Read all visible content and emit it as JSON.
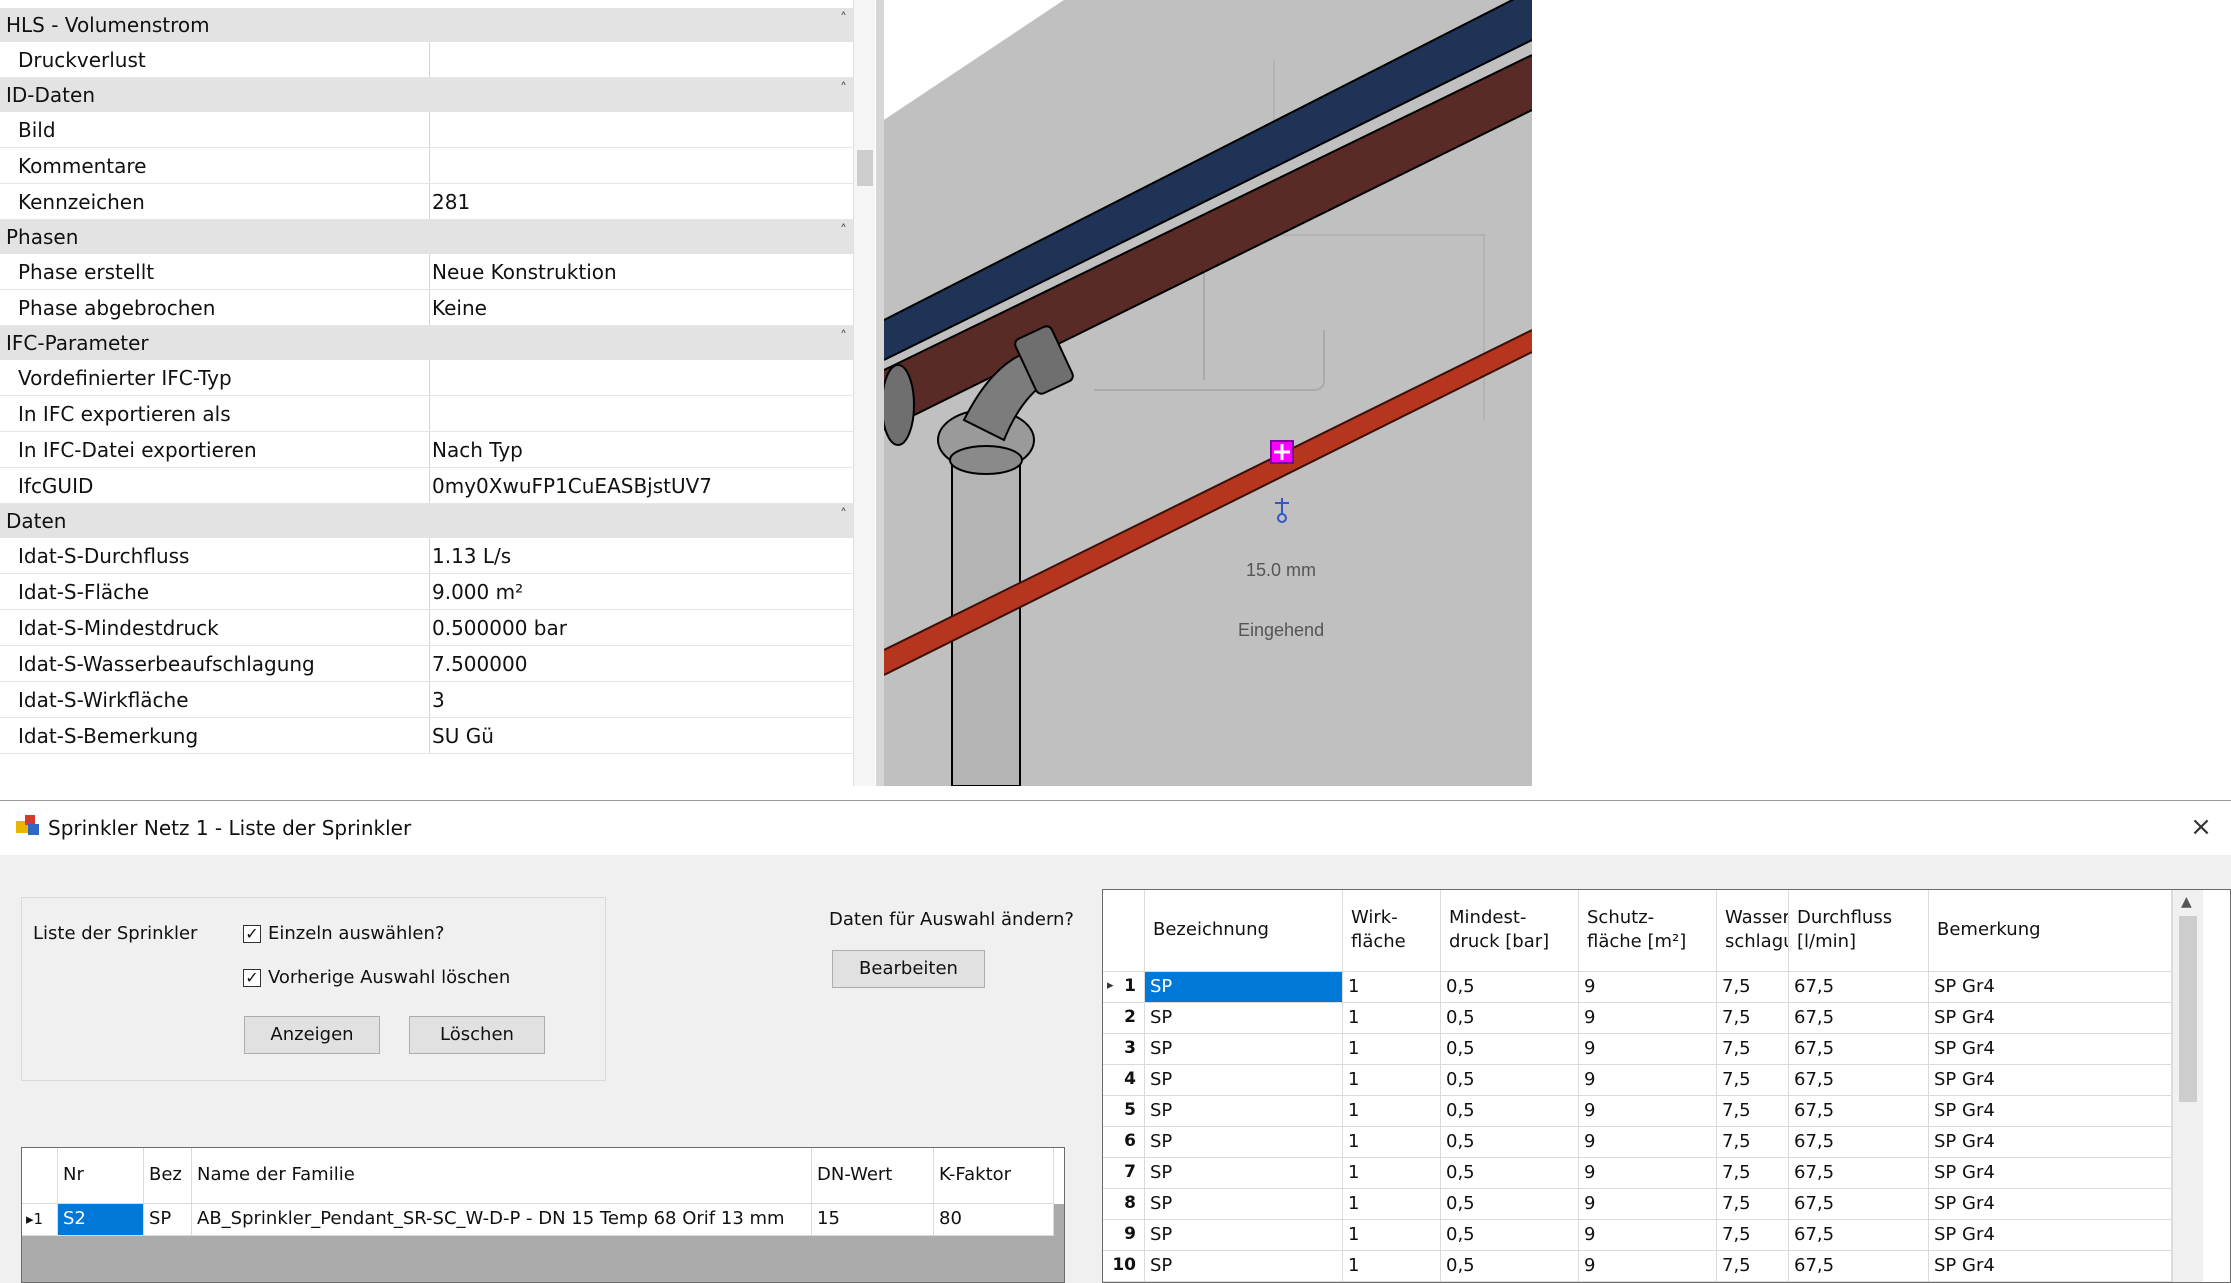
{
  "properties": {
    "groups": [
      {
        "title": "HLS - Volumenstrom",
        "rows": [
          {
            "name": "Druckverlust",
            "value": ""
          }
        ]
      },
      {
        "title": "ID-Daten",
        "rows": [
          {
            "name": "Bild",
            "value": ""
          },
          {
            "name": "Kommentare",
            "value": ""
          },
          {
            "name": "Kennzeichen",
            "value": "281"
          }
        ]
      },
      {
        "title": "Phasen",
        "rows": [
          {
            "name": "Phase erstellt",
            "value": "Neue Konstruktion"
          },
          {
            "name": "Phase abgebrochen",
            "value": "Keine"
          }
        ]
      },
      {
        "title": "IFC-Parameter",
        "rows": [
          {
            "name": "Vordefinierter IFC-Typ",
            "value": ""
          },
          {
            "name": "In IFC exportieren als",
            "value": ""
          },
          {
            "name": "In IFC-Datei exportieren",
            "value": "Nach Typ"
          },
          {
            "name": "IfcGUID",
            "value": "0my0XwuFP1CuEASBjstUV7"
          }
        ]
      },
      {
        "title": "Daten",
        "rows": [
          {
            "name": "Idat-S-Durchfluss",
            "value": "1.13 L/s"
          },
          {
            "name": "Idat-S-Fläche",
            "value": "9.000 m²"
          },
          {
            "name": "Idat-S-Mindestdruck",
            "value": "0.500000 bar"
          },
          {
            "name": "Idat-S-Wasserbeaufschlagung",
            "value": "7.500000"
          },
          {
            "name": "Idat-S-Wirkfläche",
            "value": "3"
          },
          {
            "name": "Idat-S-Bemerkung",
            "value": "SU Gü"
          }
        ]
      }
    ]
  },
  "viewport": {
    "dimension_label": "15.0 mm",
    "flow_label": "Eingehend"
  },
  "dialog": {
    "title": "Sprinkler Netz 1 - Liste der Sprinkler",
    "close_glyph": "×",
    "liste_label": "Liste der Sprinkler",
    "checkbox_single": {
      "label": "Einzeln auswählen?",
      "checked": true
    },
    "checkbox_clear": {
      "label": "Vorherige Auswahl löschen",
      "checked": true
    },
    "btn_show": "Anzeigen",
    "btn_delete": "Löschen",
    "edit_label": "Daten für Auswahl ändern?",
    "btn_edit": "Bearbeiten"
  },
  "family_grid": {
    "headers": [
      "Nr",
      "Bez",
      "Name der Familie",
      "DN-Wert",
      "K-Faktor"
    ],
    "rows": [
      {
        "marker": "▸1",
        "nr": "S2",
        "bez": "SP",
        "name": "AB_Sprinkler_Pendant_SR-SC_W-D-P - DN 15 Temp 68 Orif 13 mm",
        "dn": "15",
        "k": "80"
      }
    ]
  },
  "sprinkler_grid": {
    "headers": [
      "Bezeichnung",
      "Wirk-\nfläche",
      "Mindest-\ndruck [bar]",
      "Schutz-\nfläche [m²]",
      "Wasser-\nschlagung",
      "Durchfluss\n[l/min]",
      "Bemerkung"
    ],
    "current_marker": "▸",
    "rows": [
      {
        "n": "1",
        "bez": "SP",
        "wirk": "1",
        "mind": "0,5",
        "schutz": "9",
        "wasser": "7,5",
        "durch": "67,5",
        "bem": "SP Gr4"
      },
      {
        "n": "2",
        "bez": "SP",
        "wirk": "1",
        "mind": "0,5",
        "schutz": "9",
        "wasser": "7,5",
        "durch": "67,5",
        "bem": "SP Gr4"
      },
      {
        "n": "3",
        "bez": "SP",
        "wirk": "1",
        "mind": "0,5",
        "schutz": "9",
        "wasser": "7,5",
        "durch": "67,5",
        "bem": "SP Gr4"
      },
      {
        "n": "4",
        "bez": "SP",
        "wirk": "1",
        "mind": "0,5",
        "schutz": "9",
        "wasser": "7,5",
        "durch": "67,5",
        "bem": "SP Gr4"
      },
      {
        "n": "5",
        "bez": "SP",
        "wirk": "1",
        "mind": "0,5",
        "schutz": "9",
        "wasser": "7,5",
        "durch": "67,5",
        "bem": "SP Gr4"
      },
      {
        "n": "6",
        "bez": "SP",
        "wirk": "1",
        "mind": "0,5",
        "schutz": "9",
        "wasser": "7,5",
        "durch": "67,5",
        "bem": "SP Gr4"
      },
      {
        "n": "7",
        "bez": "SP",
        "wirk": "1",
        "mind": "0,5",
        "schutz": "9",
        "wasser": "7,5",
        "durch": "67,5",
        "bem": "SP Gr4"
      },
      {
        "n": "8",
        "bez": "SP",
        "wirk": "1",
        "mind": "0,5",
        "schutz": "9",
        "wasser": "7,5",
        "durch": "67,5",
        "bem": "SP Gr4"
      },
      {
        "n": "9",
        "bez": "SP",
        "wirk": "1",
        "mind": "0,5",
        "schutz": "9",
        "wasser": "7,5",
        "durch": "67,5",
        "bem": "SP Gr4"
      },
      {
        "n": "10",
        "bez": "SP",
        "wirk": "1",
        "mind": "0,5",
        "schutz": "9",
        "wasser": "7,5",
        "durch": "67,5",
        "bem": "SP Gr4"
      }
    ]
  },
  "colors": {
    "selection": "#0078d7",
    "pipe_blue": "#1f3356",
    "pipe_brown": "#5a2a27",
    "pipe_red": "#b5351f",
    "sprinkler_marker": "#ff00ff"
  }
}
